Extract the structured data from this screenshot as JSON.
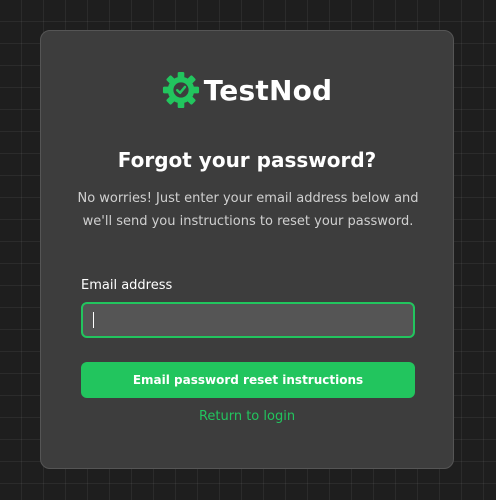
{
  "brand": {
    "name": "TestNod",
    "icon": "gear-check-icon",
    "accent_color": "#22c55e"
  },
  "title": "Forgot your password?",
  "description": "No worries! Just enter your email address below and we'll send you instructions to reset your password.",
  "form": {
    "email_label": "Email address",
    "email_value": "",
    "submit_label": "Email password reset instructions"
  },
  "return_link": "Return to login"
}
